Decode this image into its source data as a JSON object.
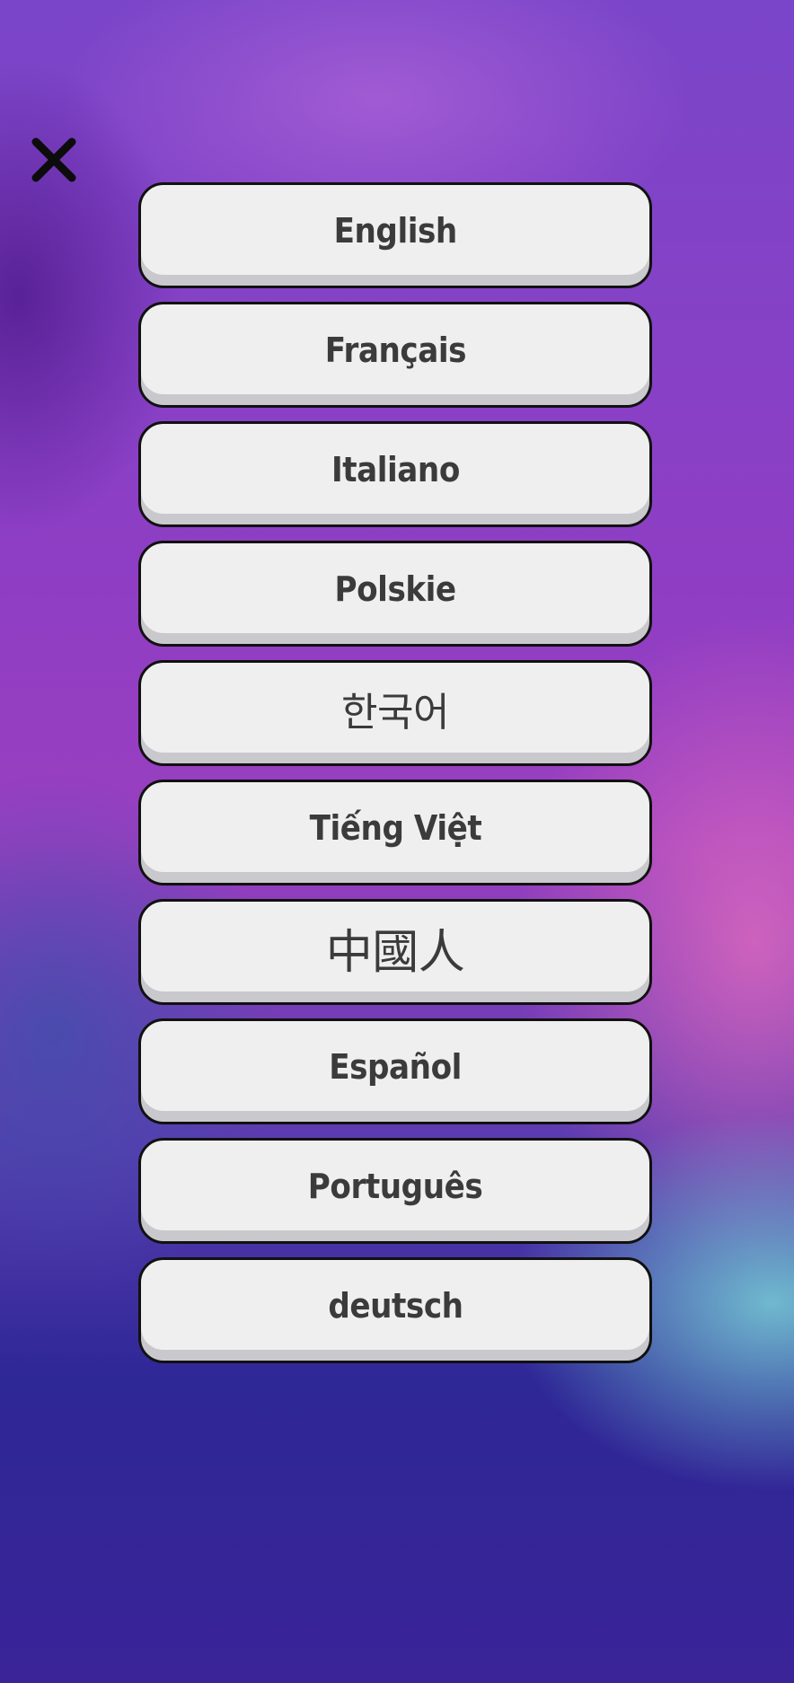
{
  "close": {
    "icon": "close-icon"
  },
  "languages": [
    {
      "label": "English"
    },
    {
      "label": "Français"
    },
    {
      "label": "Italiano"
    },
    {
      "label": "Polskie"
    },
    {
      "label": "한국어"
    },
    {
      "label": "Tiếng Việt"
    },
    {
      "label": "中國人"
    },
    {
      "label": "Español"
    },
    {
      "label": "Português"
    },
    {
      "label": "deutsch"
    }
  ]
}
